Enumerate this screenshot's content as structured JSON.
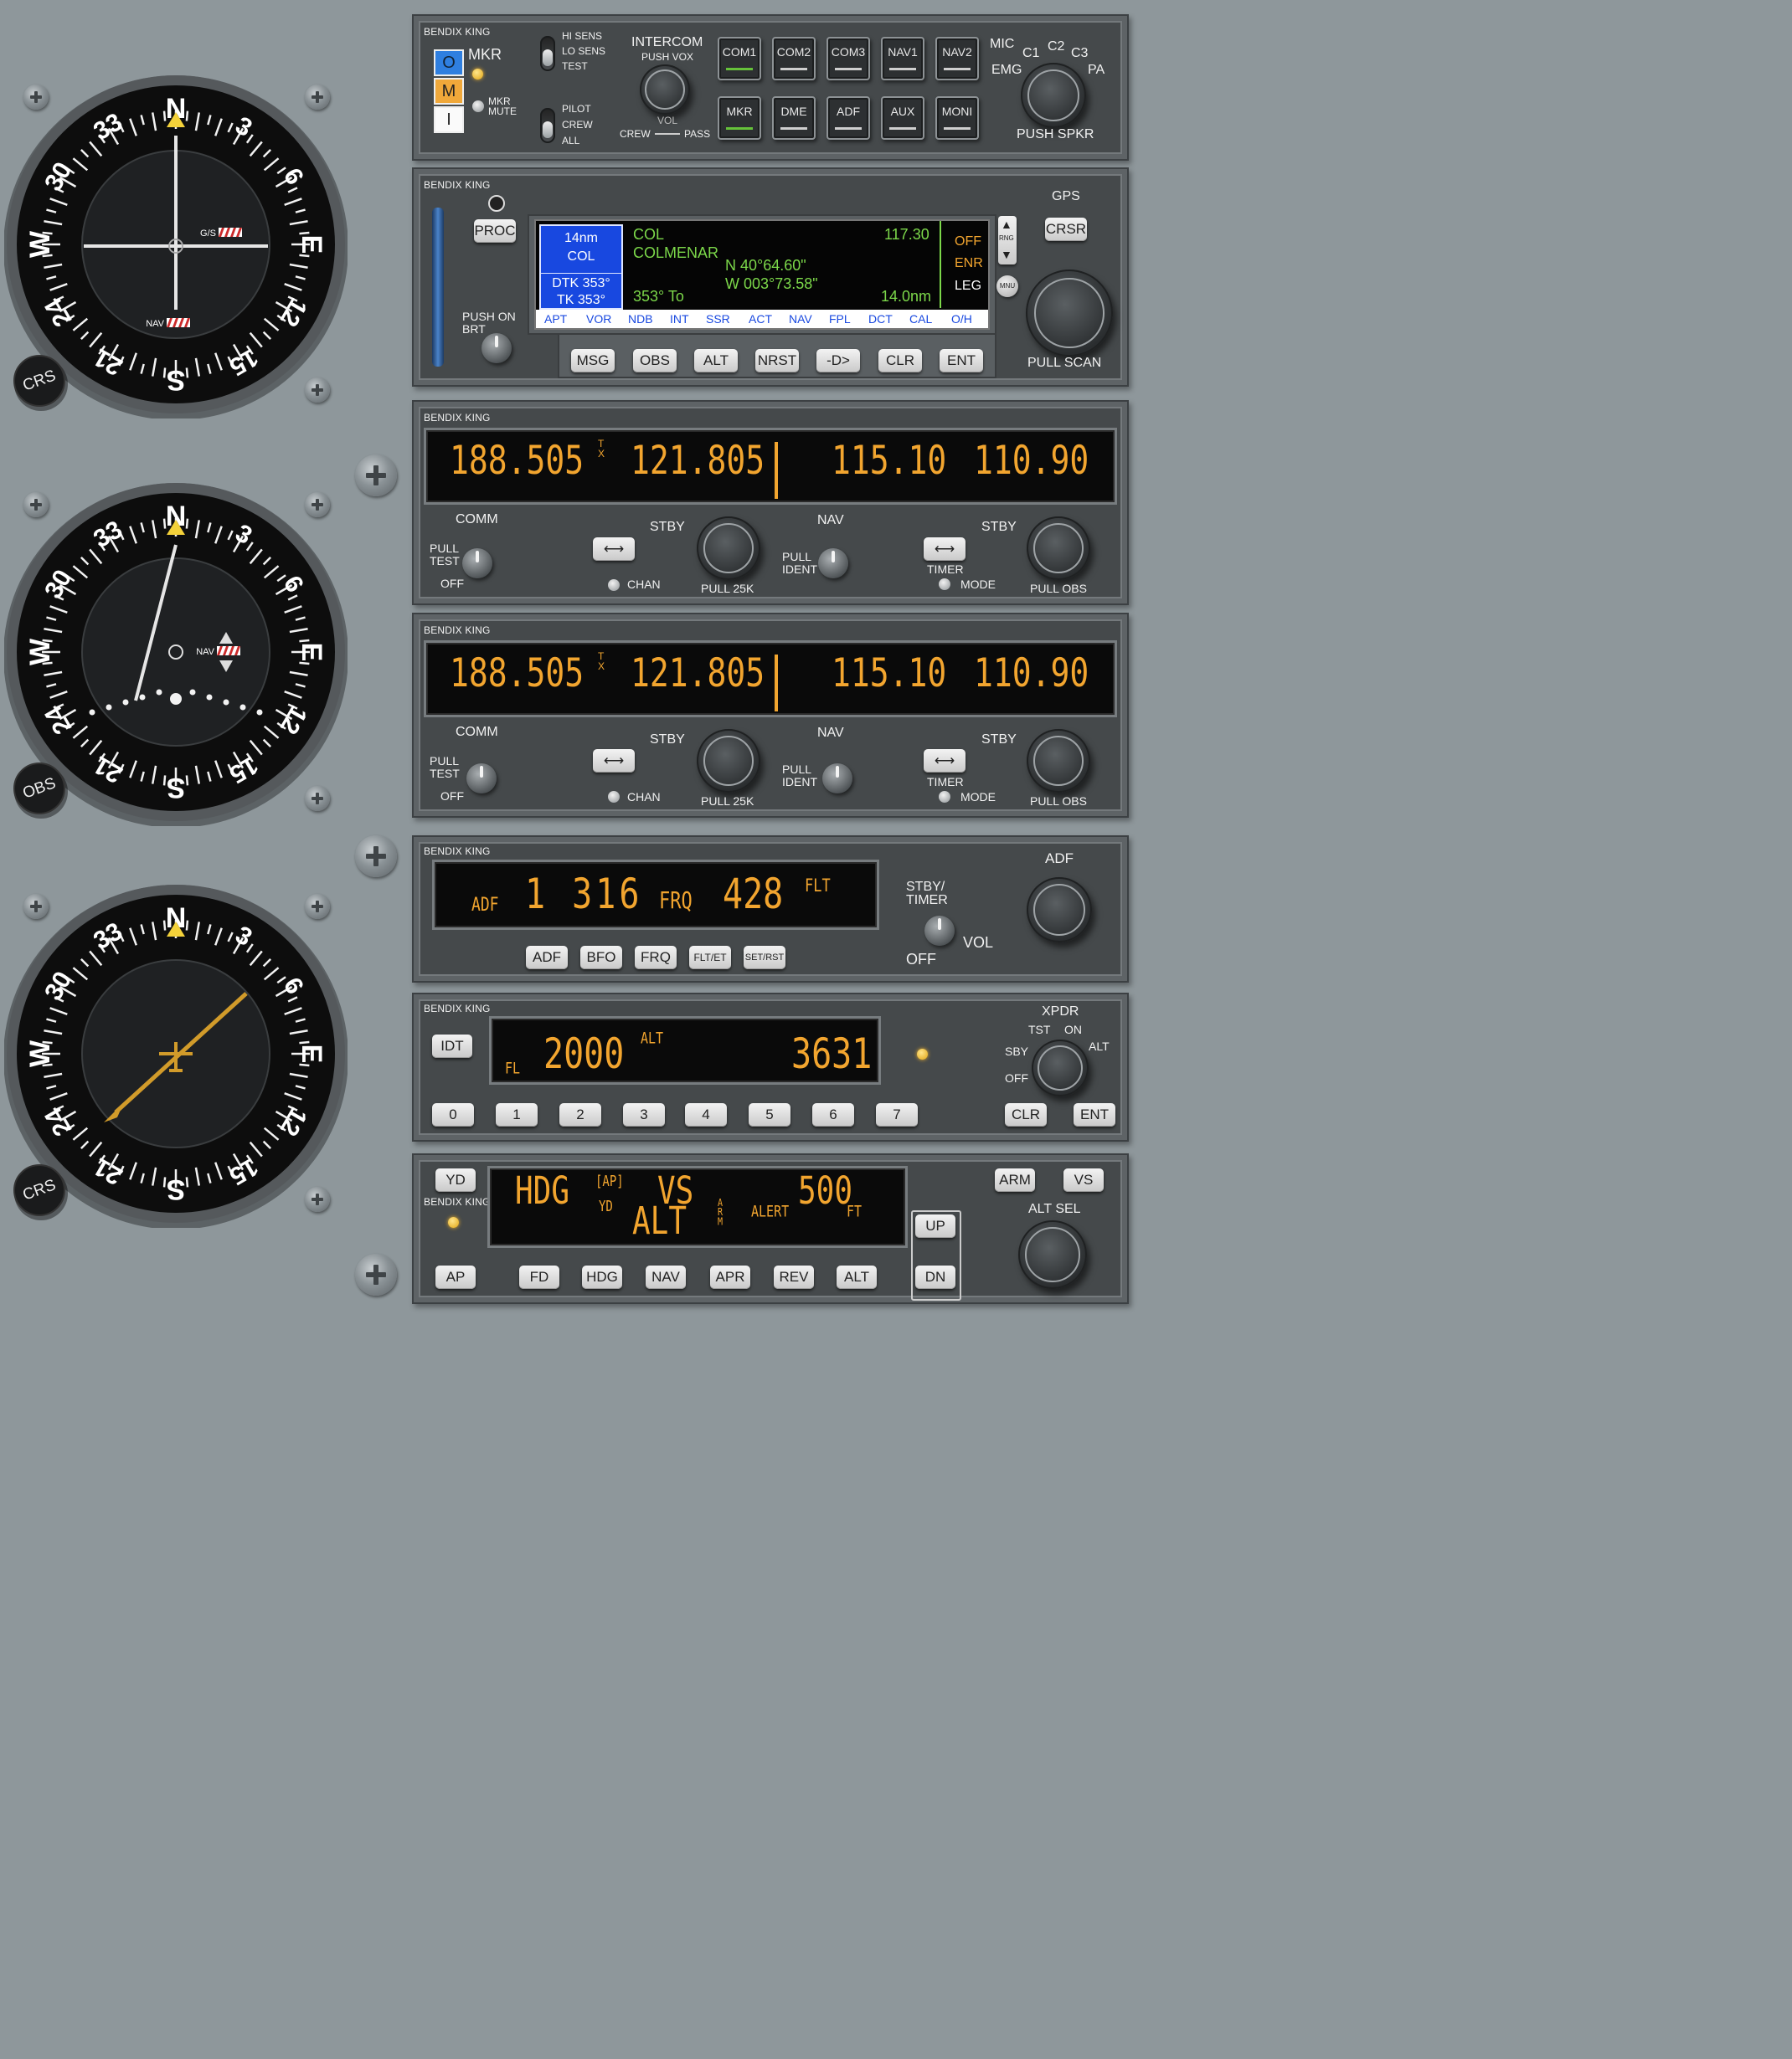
{
  "brand": "BENDIX KING",
  "left_gauges": {
    "g1": {
      "label": "CRS",
      "flag_gs": "G/S",
      "flag_nav": "NAV"
    },
    "g2": {
      "label": "OBS",
      "flag_nav": "NAV"
    },
    "g3": {
      "label": "CRS"
    },
    "cardinals": [
      "N",
      "3",
      "6",
      "E",
      "12",
      "15",
      "S",
      "21",
      "24",
      "W",
      "30",
      "33"
    ]
  },
  "audio_panel": {
    "markers": [
      "O",
      "M",
      "I"
    ],
    "mkr": "MKR",
    "mkr_mute": "MKR\nMUTE",
    "sens": [
      "HI SENS",
      "LO SENS",
      "TEST"
    ],
    "pilot": [
      "PILOT",
      "CREW",
      "ALL"
    ],
    "intercom": "INTERCOM",
    "push_vox": "PUSH VOX",
    "vol": "VOL",
    "crew": "CREW",
    "pass": "PASS",
    "buttons_top": [
      "COM1",
      "COM2",
      "COM3",
      "NAV1",
      "NAV2"
    ],
    "buttons_bottom": [
      "MKR",
      "DME",
      "ADF",
      "AUX",
      "MONI"
    ],
    "mic": "MIC",
    "c1": "C1",
    "c2": "C2",
    "c3": "C3",
    "emg": "EMG",
    "pa": "PA",
    "push_spkr": "PUSH SPKR"
  },
  "gps": {
    "proc": "PROC",
    "push_on_brt": "PUSH ON\nBRT",
    "gps_label": "GPS",
    "crsr": "CRSR",
    "rng": "RNG",
    "mnu": "MNU",
    "pull_scan": "PULL  SCAN",
    "wpt_dist": "14nm",
    "wpt_id": "COL",
    "dtk": "DTK 353°",
    "tk": "TK 353°",
    "id": "COL",
    "name": "COLMENAR",
    "freq": "117.30",
    "lat": "N 40°64.60\"",
    "lon": "W 003°73.58\"",
    "bearing": "353° To",
    "distance": "14.0nm",
    "modes": [
      "OFF",
      "ENR",
      "LEG"
    ],
    "tabs": [
      "APT",
      "VOR",
      "NDB",
      "INT",
      "SSR",
      "ACT",
      "NAV",
      "FPL",
      "DCT",
      "CAL",
      "O/H"
    ],
    "buttons": [
      "MSG",
      "OBS",
      "ALT",
      "NRST",
      "-D>",
      "CLR",
      "ENT"
    ]
  },
  "navcom": {
    "com_active": "188.505",
    "com_stby": "121.805",
    "nav_active": "115.10",
    "nav_stby": "110.90",
    "tx": "T\nX",
    "comm": "COMM",
    "pull_test": "PULL\nTEST",
    "off": "OFF",
    "stby": "STBY",
    "chan": "CHAN",
    "pull_25k": "PULL 25K",
    "nav": "NAV",
    "pull_ident": "PULL\nIDENT",
    "timer": "TIMER",
    "mode": "MODE",
    "pull_obs": "PULL OBS"
  },
  "adf": {
    "adf_tag": "ADF",
    "active": "1 316",
    "frq_tag": "FRQ",
    "freq": "428",
    "flt": "FLT",
    "title": "ADF",
    "stby_timer": "STBY/\nTIMER",
    "vol": "VOL",
    "off": "OFF",
    "buttons": [
      "ADF",
      "BFO",
      "FRQ",
      "FLT/ET",
      "SET/RST"
    ]
  },
  "xpdr": {
    "idt": "IDT",
    "fl": "FL",
    "alt_value": "2000",
    "alt_tag": "ALT",
    "code": "3631",
    "title": "XPDR",
    "tst": "TST",
    "on": "ON",
    "alt": "ALT",
    "sby": "SBY",
    "off": "OFF",
    "keys": [
      "0",
      "1",
      "2",
      "3",
      "4",
      "5",
      "6",
      "7"
    ],
    "clr": "CLR",
    "ent": "ENT"
  },
  "autopilot": {
    "yd": "YD",
    "hdg": "HDG",
    "api": "[AP]",
    "yd_ann": "YD",
    "vs": "VS",
    "vs_value": "500",
    "alt": "ALT",
    "arm": "ARM",
    "alert": "ALERT",
    "ft": "FT",
    "buttons": [
      "AP",
      "FD",
      "HDG",
      "NAV",
      "APR",
      "REV",
      "ALT"
    ],
    "up": "UP",
    "dn": "DN",
    "arm_btn": "ARM",
    "vs_btn": "VS",
    "alt_sel": "ALT SEL"
  },
  "colors": {
    "amber": "#f2a52f",
    "green": "#7cd84a",
    "yellow_pointer": "#f4d23a"
  }
}
